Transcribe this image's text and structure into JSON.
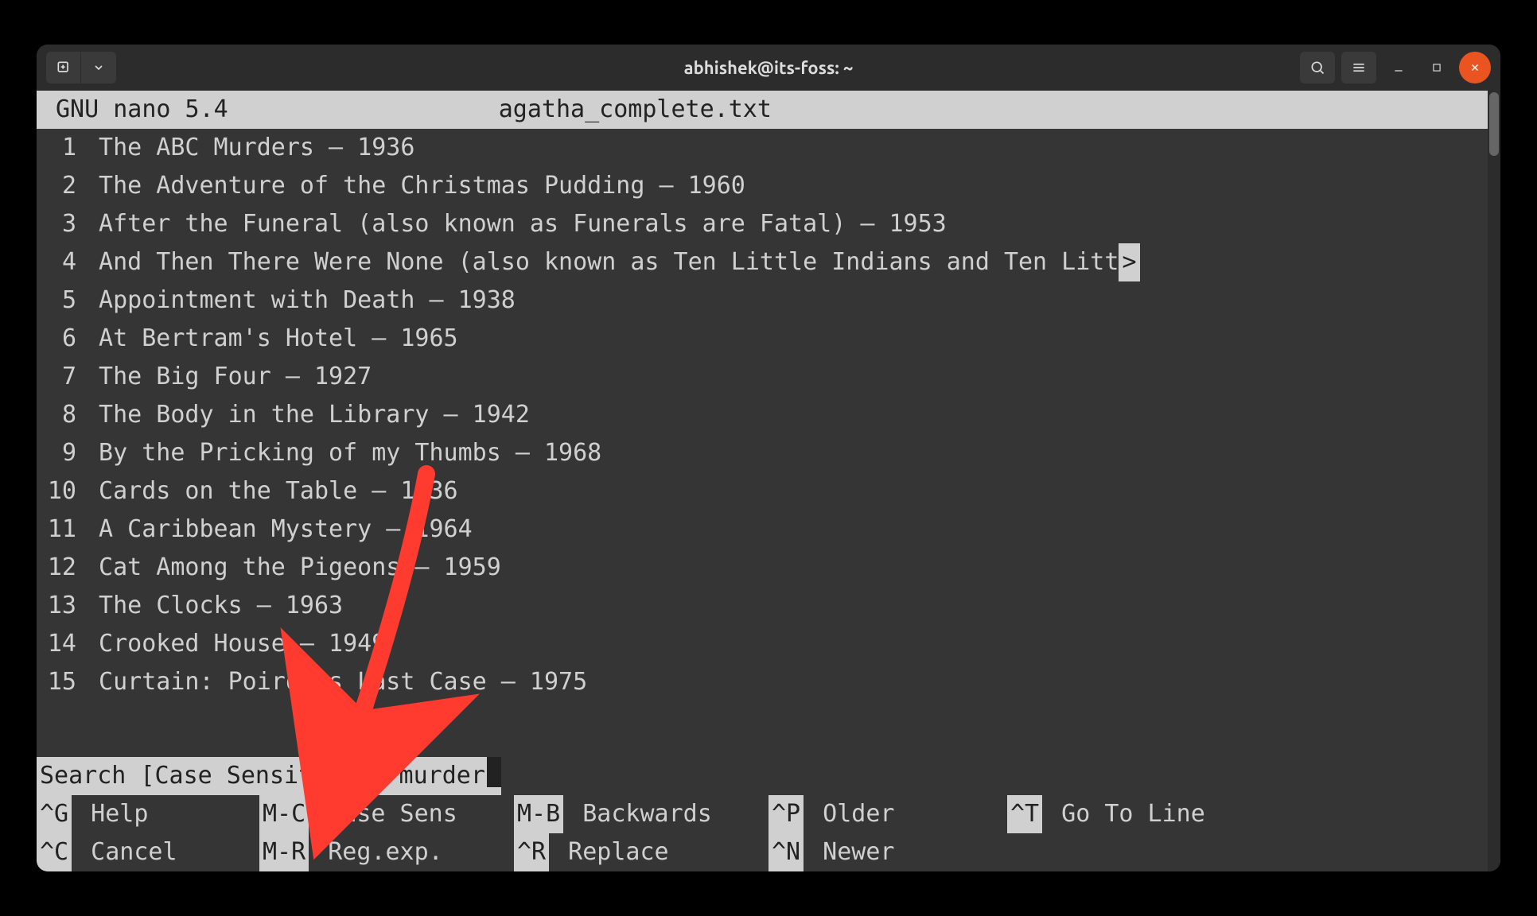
{
  "titlebar": {
    "title": "abhishek@its-foss: ~"
  },
  "nano": {
    "app": "GNU nano 5.4",
    "filename": "agatha_complete.txt"
  },
  "lines": [
    {
      "n": "1",
      "t": "The ABC Murders – 1936"
    },
    {
      "n": "2",
      "t": "The Adventure of the Christmas Pudding – 1960"
    },
    {
      "n": "3",
      "t": "After the Funeral (also known as Funerals are Fatal) – 1953"
    },
    {
      "n": "4",
      "t": "And Then There Were None (also known as Ten Little Indians and Ten Litt",
      "overflow": ">"
    },
    {
      "n": "5",
      "t": "Appointment with Death – 1938"
    },
    {
      "n": "6",
      "t": "At Bertram's Hotel – 1965"
    },
    {
      "n": "7",
      "t": "The Big Four – 1927"
    },
    {
      "n": "8",
      "t": "The Body in the Library – 1942"
    },
    {
      "n": "9",
      "t": "By the Pricking of my Thumbs – 1968"
    },
    {
      "n": "10",
      "t": "Cards on the Table – 1936"
    },
    {
      "n": "11",
      "t": "A Caribbean Mystery – 1964"
    },
    {
      "n": "12",
      "t": "Cat Among the Pigeons – 1959"
    },
    {
      "n": "13",
      "t": "The Clocks – 1963"
    },
    {
      "n": "14",
      "t": "Crooked House – 1949"
    },
    {
      "n": "15",
      "t": "Curtain: Poirot's Last Case – 1975"
    }
  ],
  "search": {
    "prompt": "Search [Case Sensitive]: ",
    "value": "murder"
  },
  "help": [
    [
      {
        "key": "^G",
        "label": "Help"
      },
      {
        "key": "M-C",
        "label": "Case Sens"
      },
      {
        "key": "M-B",
        "label": "Backwards"
      },
      {
        "key": "^P",
        "label": "Older"
      },
      {
        "key": "^T",
        "label": "Go To Line"
      }
    ],
    [
      {
        "key": "^C",
        "label": "Cancel"
      },
      {
        "key": "M-R",
        "label": "Reg.exp."
      },
      {
        "key": "^R",
        "label": "Replace"
      },
      {
        "key": "^N",
        "label": "Newer"
      }
    ]
  ],
  "colors": {
    "accent_close": "#e95420",
    "arrow": "#ff3b30"
  }
}
